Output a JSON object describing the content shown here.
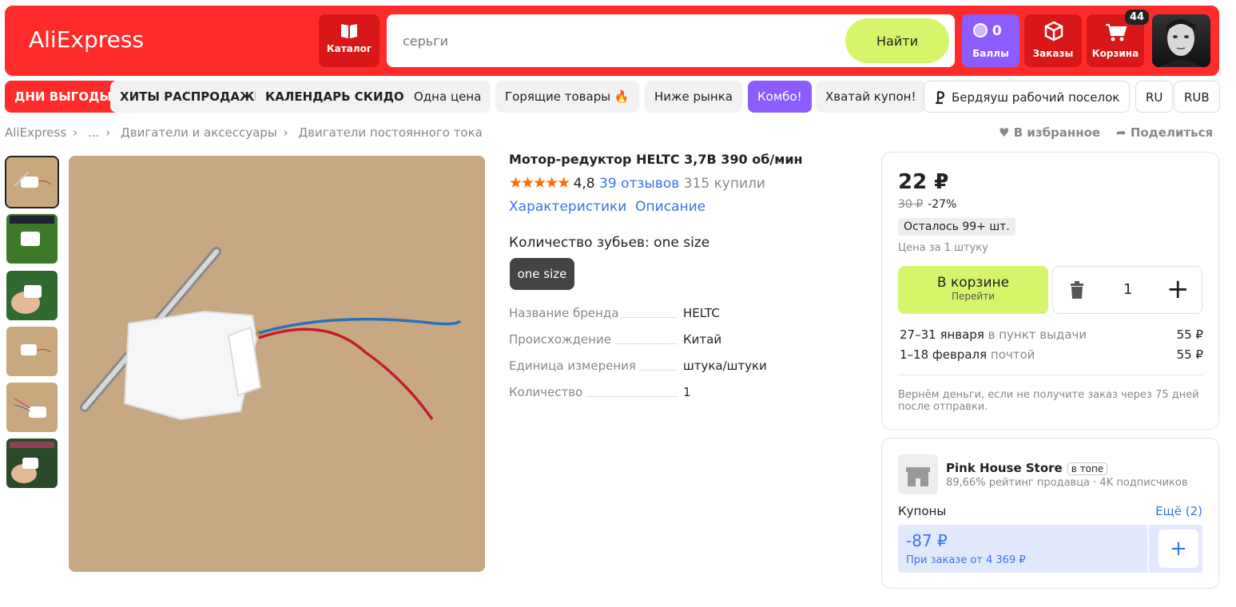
{
  "header": {
    "logo": "AliExpress",
    "catalog_label": "Каталог",
    "search_placeholder": "серьги",
    "search_button": "Найти",
    "bonus_count": "0",
    "bonus_label": "Баллы",
    "orders_label": "Заказы",
    "cart_label": "Корзина",
    "cart_count": "44"
  },
  "promo": {
    "items": [
      "ДНИ ВЫГОДЫ",
      "ХИТЫ РАСПРОДАЖИ",
      "КАЛЕНДАРЬ СКИДОК",
      "Одна цена",
      "Горящие товары 🔥",
      "Ниже рынка",
      "Комбо!",
      "Хватай купон!"
    ],
    "location": "Бердяуш рабочий поселок",
    "lang": "RU",
    "currency": "RUB"
  },
  "breadcrumb": {
    "items": [
      "AliExpress",
      "...",
      "Двигатели и аксессуары",
      "Двигатели постоянного тока"
    ],
    "favorite": "В избранное",
    "share": "Поделиться"
  },
  "product": {
    "title": "Мотор-редуктор HELTC 3,7В 390 об/мин",
    "stars": "★★★★★",
    "rating": "4,8",
    "reviews": "39 отзывов",
    "bought": "315 купили",
    "link_specs": "Характеристики",
    "link_desc": "Описание",
    "option_label": "Количество зубьев: one size",
    "option_value": "one size",
    "specs": [
      {
        "k": "Название бренда",
        "v": "HELTC"
      },
      {
        "k": "Происхождение",
        "v": "Китай"
      },
      {
        "k": "Единица измерения",
        "v": "штука/штуки"
      },
      {
        "k": "Количество",
        "v": "1"
      }
    ]
  },
  "buy": {
    "price": "22 ₽",
    "old_price": "30 ₽",
    "discount": "-27%",
    "stock": "Осталось 99+ шт.",
    "per_unit": "Цена за 1 штуку",
    "in_cart": "В корзине",
    "go": "Перейти",
    "qty": "1",
    "delivery": [
      {
        "date": "27–31 января",
        "method": "в пункт выдачи",
        "price": "55 ₽"
      },
      {
        "date": "1–18 февраля",
        "method": "почтой",
        "price": "55 ₽"
      }
    ],
    "refund": "Вернём деньги, если не получите заказ через 75 дней после отправки."
  },
  "store": {
    "name": "Pink House Store",
    "badge": "в топе",
    "meta": "89,66% рейтинг продавца · 4K подписчиков",
    "coupons_label": "Купоны",
    "more": "Ещё (2)",
    "coupon_amount": "-87 ₽",
    "coupon_condition": "При заказе от 4 369 ₽"
  },
  "colors": {
    "brand_red": "#ff2b2b",
    "accent_green": "#d6f56a",
    "accent_purple": "#8c5cff",
    "link_blue": "#3b74e6"
  }
}
